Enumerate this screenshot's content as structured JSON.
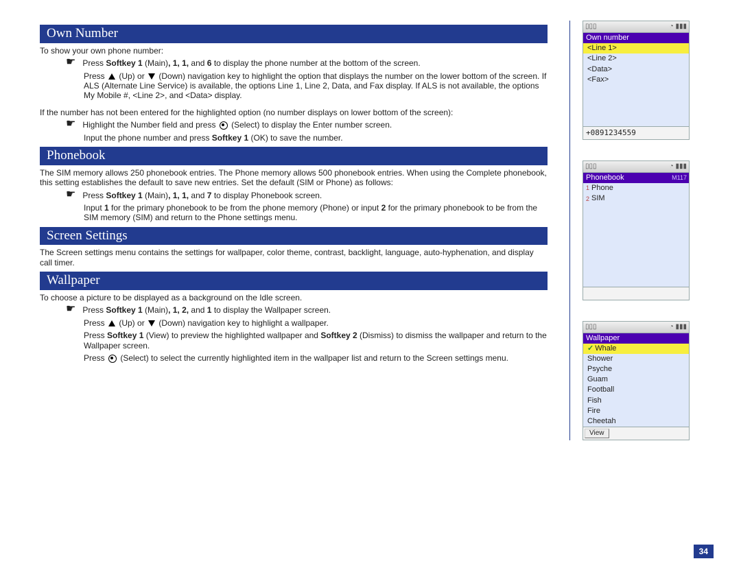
{
  "page_number": "34",
  "sections": {
    "own_number": {
      "heading": "Own Number",
      "intro": "To show your own phone number:",
      "b1_pre": "Press ",
      "b1_bold": "Softkey 1",
      "b1_mid": " (Main)",
      "b1_bold2": ", 1, 1,",
      "b1_mid2": " and ",
      "b1_bold3": "6",
      "b1_post": " to display the phone number at the bottom of the screen.",
      "s1a": "Press ",
      "s1b": " (Up) or ",
      "s1c": " (Down) navigation key to highlight the option that displays the number on the lower bottom of the screen. If ALS (Alternate Line Service) is available, the options Line 1, Line 2, Data, and Fax display. If ALS is not available, the options My Mobile #, <Line 2>, and <Data> display.",
      "p2": "If the number has not been entered for the highlighted option (no number displays on lower bottom of the screen):",
      "b2_pre": "Highlight the Number field and press ",
      "b2_post": " (Select) to display the Enter number screen.",
      "s2_pre": "Input the phone number and press ",
      "s2_bold": "Softkey 1",
      "s2_post": " (OK) to save the number."
    },
    "phonebook": {
      "heading": "Phonebook",
      "intro": "The SIM memory allows 250 phonebook entries. The Phone memory allows 500 phonebook entries. When using the Complete phonebook, this setting establishes the default to save new entries. Set the default (SIM or Phone) as follows:",
      "b1_pre": "Press ",
      "b1_bold": "Softkey 1",
      "b1_mid": " (Main)",
      "b1_bold2": ", 1, 1,",
      "b1_mid2": " and ",
      "b1_bold3": "7",
      "b1_post": " to display Phonebook screen.",
      "s1_pre": "Input ",
      "s1_b1": "1",
      "s1_mid": " for the primary phonebook to be from the phone memory (Phone) or input ",
      "s1_b2": "2",
      "s1_post": " for the primary phonebook to be from the SIM memory (SIM) and return to the Phone settings menu."
    },
    "screen": {
      "heading": "Screen Settings",
      "intro": "The Screen settings menu contains the settings for wallpaper, color theme, contrast, backlight, language, auto-hyphenation, and display call timer."
    },
    "wallpaper": {
      "heading": "Wallpaper",
      "intro": "To choose a picture to be displayed as a background on the Idle screen.",
      "b1_pre": "Press ",
      "b1_bold": "Softkey 1",
      "b1_mid": " (Main)",
      "b1_bold2": ", 1, 2,",
      "b1_mid2": " and ",
      "b1_bold3": "1",
      "b1_post": " to display the Wallpaper screen.",
      "s1a": "Press ",
      "s1b": " (Up) or ",
      "s1c": " (Down) navigation key to highlight a wallpaper.",
      "s2_pre": "Press ",
      "s2_b1": "Softkey 1",
      "s2_mid": " (View) to preview the highlighted wallpaper and ",
      "s2_b2": "Softkey 2",
      "s2_post": " (Dismiss) to dismiss the wallpaper and return to the Wallpaper screen.",
      "s3_pre": "Press ",
      "s3_post": " (Select) to select the currently highlighted item in the wallpaper list and return to the Screen settings menu."
    }
  },
  "phones": {
    "own": {
      "title": "Own number",
      "items": [
        "<Line 1>",
        "<Line 2>",
        "<Data>",
        "<Fax>"
      ],
      "footer": "+0891234559"
    },
    "pbk": {
      "title": "Phonebook",
      "tag": "M117",
      "items": [
        {
          "n": "1",
          "t": "Phone"
        },
        {
          "n": "2",
          "t": "SIM"
        }
      ]
    },
    "wall": {
      "title": "Wallpaper",
      "items": [
        "Whale",
        "Shower",
        "Psyche",
        "Guam",
        "Football",
        "Fish",
        "Fire",
        "Cheetah"
      ],
      "soft": "View"
    }
  }
}
